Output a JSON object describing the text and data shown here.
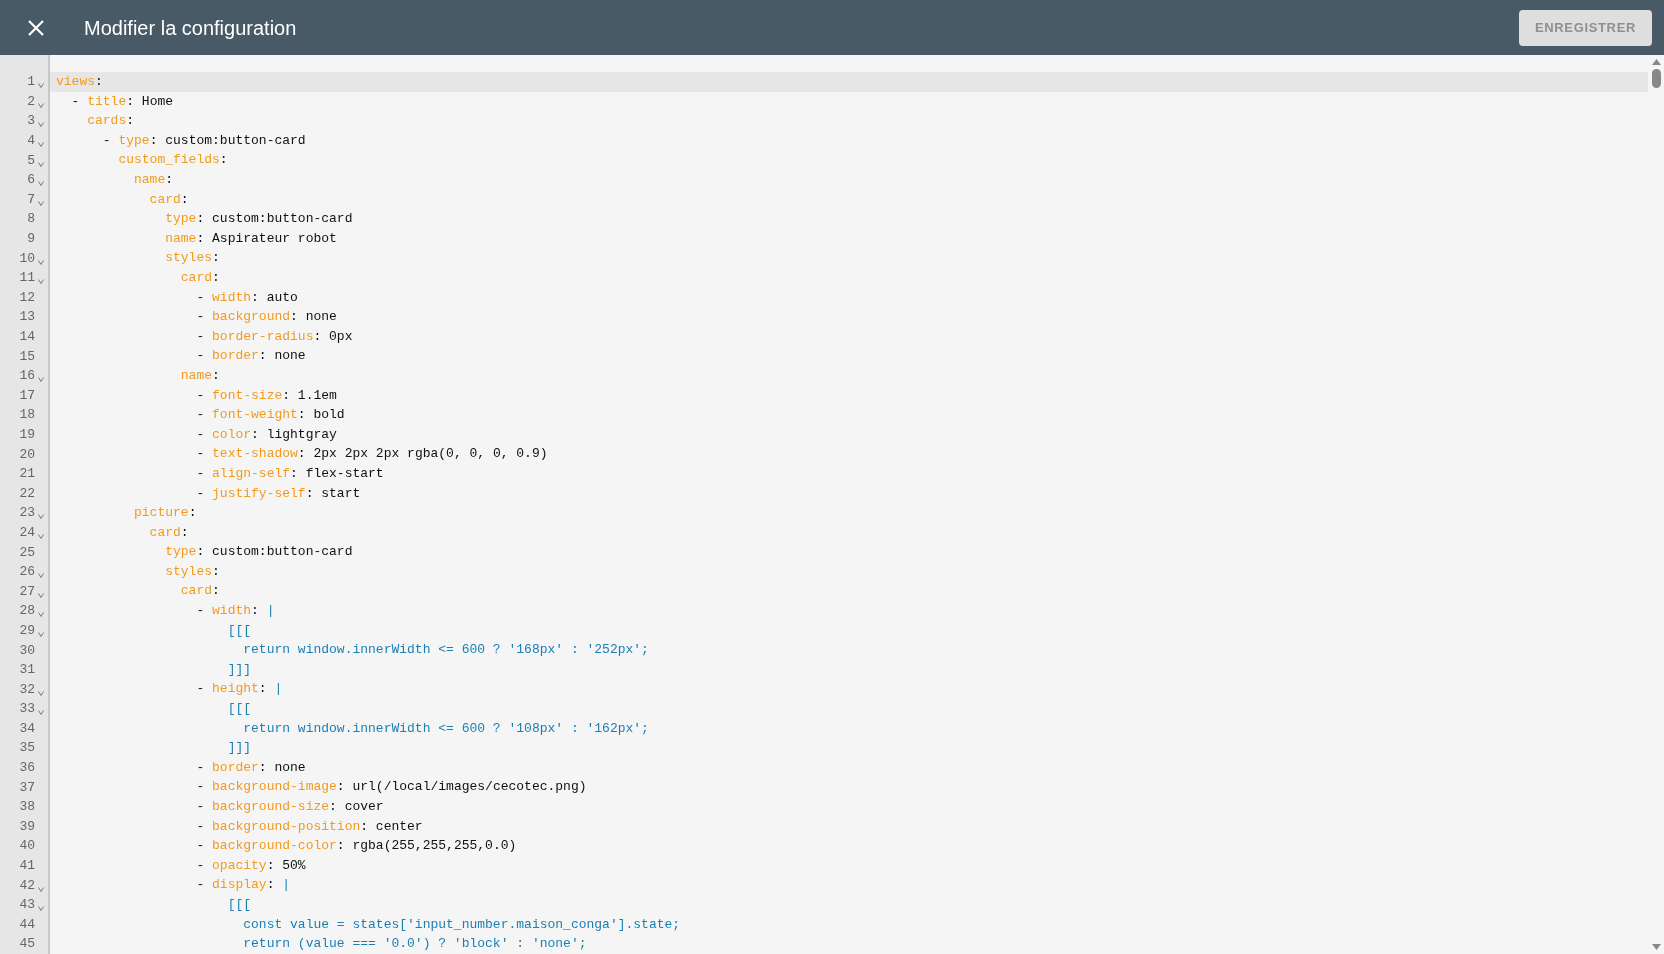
{
  "header": {
    "title": "Modifier la configuration",
    "save_button": {
      "label": "ENREGISTRER",
      "disabled": true
    }
  },
  "editor": {
    "lines": [
      {
        "number": "1",
        "foldable": true,
        "selected": true,
        "tokens": [
          {
            "kind": "key",
            "text": "views"
          },
          {
            "kind": "plain",
            "text": ":"
          }
        ]
      },
      {
        "number": "2",
        "foldable": true,
        "selected": false,
        "tokens": [
          {
            "kind": "plain",
            "text": "  - "
          },
          {
            "kind": "key",
            "text": "title"
          },
          {
            "kind": "plain",
            "text": ": Home"
          }
        ]
      },
      {
        "number": "3",
        "foldable": true,
        "selected": false,
        "tokens": [
          {
            "kind": "key",
            "text": "    cards"
          },
          {
            "kind": "plain",
            "text": ":"
          }
        ]
      },
      {
        "number": "4",
        "foldable": true,
        "selected": false,
        "tokens": [
          {
            "kind": "plain",
            "text": "      - "
          },
          {
            "kind": "key",
            "text": "type"
          },
          {
            "kind": "plain",
            "text": ": custom:button-card"
          }
        ]
      },
      {
        "number": "5",
        "foldable": true,
        "selected": false,
        "tokens": [
          {
            "kind": "key",
            "text": "        custom_fields"
          },
          {
            "kind": "plain",
            "text": ":"
          }
        ]
      },
      {
        "number": "6",
        "foldable": true,
        "selected": false,
        "tokens": [
          {
            "kind": "key",
            "text": "          name"
          },
          {
            "kind": "plain",
            "text": ":"
          }
        ]
      },
      {
        "number": "7",
        "foldable": true,
        "selected": false,
        "tokens": [
          {
            "kind": "key",
            "text": "            card"
          },
          {
            "kind": "plain",
            "text": ":"
          }
        ]
      },
      {
        "number": "8",
        "foldable": false,
        "selected": false,
        "tokens": [
          {
            "kind": "key",
            "text": "              type"
          },
          {
            "kind": "plain",
            "text": ": custom:button-card"
          }
        ]
      },
      {
        "number": "9",
        "foldable": false,
        "selected": false,
        "tokens": [
          {
            "kind": "key",
            "text": "              name"
          },
          {
            "kind": "plain",
            "text": ": Aspirateur robot"
          }
        ]
      },
      {
        "number": "10",
        "foldable": true,
        "selected": false,
        "tokens": [
          {
            "kind": "key",
            "text": "              styles"
          },
          {
            "kind": "plain",
            "text": ":"
          }
        ]
      },
      {
        "number": "11",
        "foldable": true,
        "selected": false,
        "tokens": [
          {
            "kind": "key",
            "text": "                card"
          },
          {
            "kind": "plain",
            "text": ":"
          }
        ]
      },
      {
        "number": "12",
        "foldable": false,
        "selected": false,
        "tokens": [
          {
            "kind": "plain",
            "text": "                  - "
          },
          {
            "kind": "key",
            "text": "width"
          },
          {
            "kind": "plain",
            "text": ": auto"
          }
        ]
      },
      {
        "number": "13",
        "foldable": false,
        "selected": false,
        "tokens": [
          {
            "kind": "plain",
            "text": "                  - "
          },
          {
            "kind": "key",
            "text": "background"
          },
          {
            "kind": "plain",
            "text": ": none"
          }
        ]
      },
      {
        "number": "14",
        "foldable": false,
        "selected": false,
        "tokens": [
          {
            "kind": "plain",
            "text": "                  - "
          },
          {
            "kind": "key",
            "text": "border-radius"
          },
          {
            "kind": "plain",
            "text": ": 0px"
          }
        ]
      },
      {
        "number": "15",
        "foldable": false,
        "selected": false,
        "tokens": [
          {
            "kind": "plain",
            "text": "                  - "
          },
          {
            "kind": "key",
            "text": "border"
          },
          {
            "kind": "plain",
            "text": ": none"
          }
        ]
      },
      {
        "number": "16",
        "foldable": true,
        "selected": false,
        "tokens": [
          {
            "kind": "key",
            "text": "                name"
          },
          {
            "kind": "plain",
            "text": ":"
          }
        ]
      },
      {
        "number": "17",
        "foldable": false,
        "selected": false,
        "tokens": [
          {
            "kind": "plain",
            "text": "                  - "
          },
          {
            "kind": "key",
            "text": "font-size"
          },
          {
            "kind": "plain",
            "text": ": 1.1em"
          }
        ]
      },
      {
        "number": "18",
        "foldable": false,
        "selected": false,
        "tokens": [
          {
            "kind": "plain",
            "text": "                  - "
          },
          {
            "kind": "key",
            "text": "font-weight"
          },
          {
            "kind": "plain",
            "text": ": bold"
          }
        ]
      },
      {
        "number": "19",
        "foldable": false,
        "selected": false,
        "tokens": [
          {
            "kind": "plain",
            "text": "                  - "
          },
          {
            "kind": "key",
            "text": "color"
          },
          {
            "kind": "plain",
            "text": ": lightgray"
          }
        ]
      },
      {
        "number": "20",
        "foldable": false,
        "selected": false,
        "tokens": [
          {
            "kind": "plain",
            "text": "                  - "
          },
          {
            "kind": "key",
            "text": "text-shadow"
          },
          {
            "kind": "plain",
            "text": ": 2px 2px 2px rgba(0, 0, 0, 0.9)"
          }
        ]
      },
      {
        "number": "21",
        "foldable": false,
        "selected": false,
        "tokens": [
          {
            "kind": "plain",
            "text": "                  - "
          },
          {
            "kind": "key",
            "text": "align-self"
          },
          {
            "kind": "plain",
            "text": ": flex-start"
          }
        ]
      },
      {
        "number": "22",
        "foldable": false,
        "selected": false,
        "tokens": [
          {
            "kind": "plain",
            "text": "                  - "
          },
          {
            "kind": "key",
            "text": "justify-self"
          },
          {
            "kind": "plain",
            "text": ": start"
          }
        ]
      },
      {
        "number": "23",
        "foldable": true,
        "selected": false,
        "tokens": [
          {
            "kind": "key",
            "text": "          picture"
          },
          {
            "kind": "plain",
            "text": ":"
          }
        ]
      },
      {
        "number": "24",
        "foldable": true,
        "selected": false,
        "tokens": [
          {
            "kind": "key",
            "text": "            card"
          },
          {
            "kind": "plain",
            "text": ":"
          }
        ]
      },
      {
        "number": "25",
        "foldable": false,
        "selected": false,
        "tokens": [
          {
            "kind": "key",
            "text": "              type"
          },
          {
            "kind": "plain",
            "text": ": custom:button-card"
          }
        ]
      },
      {
        "number": "26",
        "foldable": true,
        "selected": false,
        "tokens": [
          {
            "kind": "key",
            "text": "              styles"
          },
          {
            "kind": "plain",
            "text": ":"
          }
        ]
      },
      {
        "number": "27",
        "foldable": true,
        "selected": false,
        "tokens": [
          {
            "kind": "key",
            "text": "                card"
          },
          {
            "kind": "plain",
            "text": ":"
          }
        ]
      },
      {
        "number": "28",
        "foldable": true,
        "selected": false,
        "tokens": [
          {
            "kind": "plain",
            "text": "                  - "
          },
          {
            "kind": "key",
            "text": "width"
          },
          {
            "kind": "plain",
            "text": ": "
          },
          {
            "kind": "js",
            "text": "|"
          }
        ]
      },
      {
        "number": "29",
        "foldable": true,
        "selected": false,
        "tokens": [
          {
            "kind": "js",
            "text": "                      [[["
          }
        ]
      },
      {
        "number": "30",
        "foldable": false,
        "selected": false,
        "tokens": [
          {
            "kind": "js",
            "text": "                        return window.innerWidth <= 600 ? '168px' : '252px';"
          }
        ]
      },
      {
        "number": "31",
        "foldable": false,
        "selected": false,
        "tokens": [
          {
            "kind": "js",
            "text": "                      ]]]"
          }
        ]
      },
      {
        "number": "32",
        "foldable": true,
        "selected": false,
        "tokens": [
          {
            "kind": "plain",
            "text": "                  - "
          },
          {
            "kind": "key",
            "text": "height"
          },
          {
            "kind": "plain",
            "text": ": "
          },
          {
            "kind": "js",
            "text": "|"
          }
        ]
      },
      {
        "number": "33",
        "foldable": true,
        "selected": false,
        "tokens": [
          {
            "kind": "js",
            "text": "                      [[["
          }
        ]
      },
      {
        "number": "34",
        "foldable": false,
        "selected": false,
        "tokens": [
          {
            "kind": "js",
            "text": "                        return window.innerWidth <= 600 ? '108px' : '162px';"
          }
        ]
      },
      {
        "number": "35",
        "foldable": false,
        "selected": false,
        "tokens": [
          {
            "kind": "js",
            "text": "                      ]]]"
          }
        ]
      },
      {
        "number": "36",
        "foldable": false,
        "selected": false,
        "tokens": [
          {
            "kind": "plain",
            "text": "                  - "
          },
          {
            "kind": "key",
            "text": "border"
          },
          {
            "kind": "plain",
            "text": ": none"
          }
        ]
      },
      {
        "number": "37",
        "foldable": false,
        "selected": false,
        "tokens": [
          {
            "kind": "plain",
            "text": "                  - "
          },
          {
            "kind": "key",
            "text": "background-image"
          },
          {
            "kind": "plain",
            "text": ": url(/local/images/cecotec.png)"
          }
        ]
      },
      {
        "number": "38",
        "foldable": false,
        "selected": false,
        "tokens": [
          {
            "kind": "plain",
            "text": "                  - "
          },
          {
            "kind": "key",
            "text": "background-size"
          },
          {
            "kind": "plain",
            "text": ": cover"
          }
        ]
      },
      {
        "number": "39",
        "foldable": false,
        "selected": false,
        "tokens": [
          {
            "kind": "plain",
            "text": "                  - "
          },
          {
            "kind": "key",
            "text": "background-position"
          },
          {
            "kind": "plain",
            "text": ": center"
          }
        ]
      },
      {
        "number": "40",
        "foldable": false,
        "selected": false,
        "tokens": [
          {
            "kind": "plain",
            "text": "                  - "
          },
          {
            "kind": "key",
            "text": "background-color"
          },
          {
            "kind": "plain",
            "text": ": rgba(255,255,255,0.0)"
          }
        ]
      },
      {
        "number": "41",
        "foldable": false,
        "selected": false,
        "tokens": [
          {
            "kind": "plain",
            "text": "                  - "
          },
          {
            "kind": "key",
            "text": "opacity"
          },
          {
            "kind": "plain",
            "text": ": 50%"
          }
        ]
      },
      {
        "number": "42",
        "foldable": true,
        "selected": false,
        "tokens": [
          {
            "kind": "plain",
            "text": "                  - "
          },
          {
            "kind": "key",
            "text": "display"
          },
          {
            "kind": "plain",
            "text": ": "
          },
          {
            "kind": "js",
            "text": "|"
          }
        ]
      },
      {
        "number": "43",
        "foldable": true,
        "selected": false,
        "tokens": [
          {
            "kind": "js",
            "text": "                      [[["
          }
        ]
      },
      {
        "number": "44",
        "foldable": false,
        "selected": false,
        "tokens": [
          {
            "kind": "js",
            "text": "                        const value = states['input_number.maison_conga'].state;"
          }
        ]
      },
      {
        "number": "45",
        "foldable": false,
        "selected": false,
        "tokens": [
          {
            "kind": "js",
            "text": "                        return (value === '0.0') ? 'block' : 'none';"
          }
        ]
      }
    ]
  }
}
